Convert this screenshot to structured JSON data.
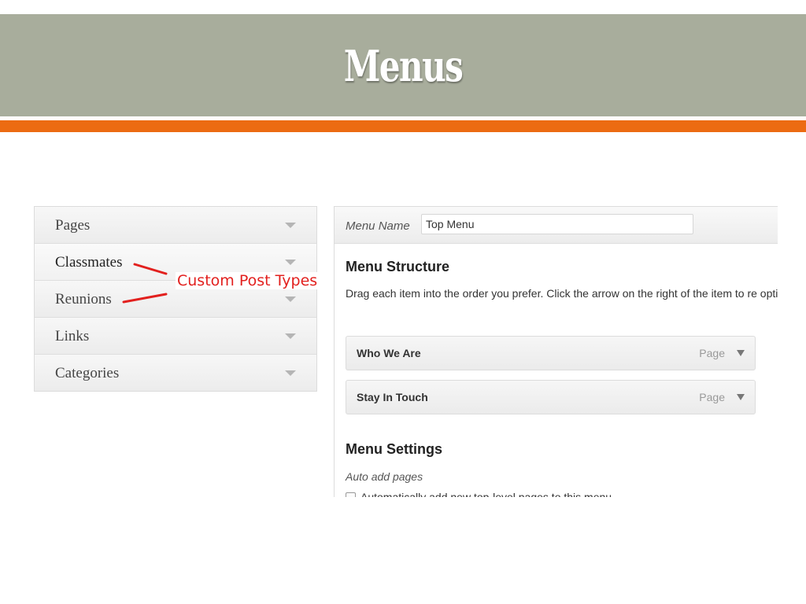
{
  "slide": {
    "title": "Menus",
    "colors": {
      "title_bar": "#a8ad9c",
      "accent_stripe": "#ec6b12",
      "annotation": "#e2201e"
    }
  },
  "meta_boxes": {
    "items": [
      {
        "label": "Pages",
        "icon": "triangle-down-icon"
      },
      {
        "label": "Classmates",
        "icon": "triangle-down-icon"
      },
      {
        "label": "Reunions",
        "icon": "triangle-down-icon"
      },
      {
        "label": "Links",
        "icon": "triangle-down-icon"
      },
      {
        "label": "Categories",
        "icon": "triangle-down-icon"
      }
    ]
  },
  "annotation": {
    "text": "Custom Post Types"
  },
  "menu_editor": {
    "menu_name_label": "Menu Name",
    "menu_name_value": "Top Menu",
    "structure_heading": "Menu Structure",
    "structure_description": "Drag each item into the order you prefer. Click the arrow on the right of the item to re options.",
    "items": [
      {
        "title": "Who We Are",
        "type": "Page"
      },
      {
        "title": "Stay In Touch",
        "type": "Page"
      }
    ],
    "settings_heading": "Menu Settings",
    "auto_add_label": "Auto add pages",
    "auto_add_text": "Automatically add new top-level pages to this menu"
  }
}
